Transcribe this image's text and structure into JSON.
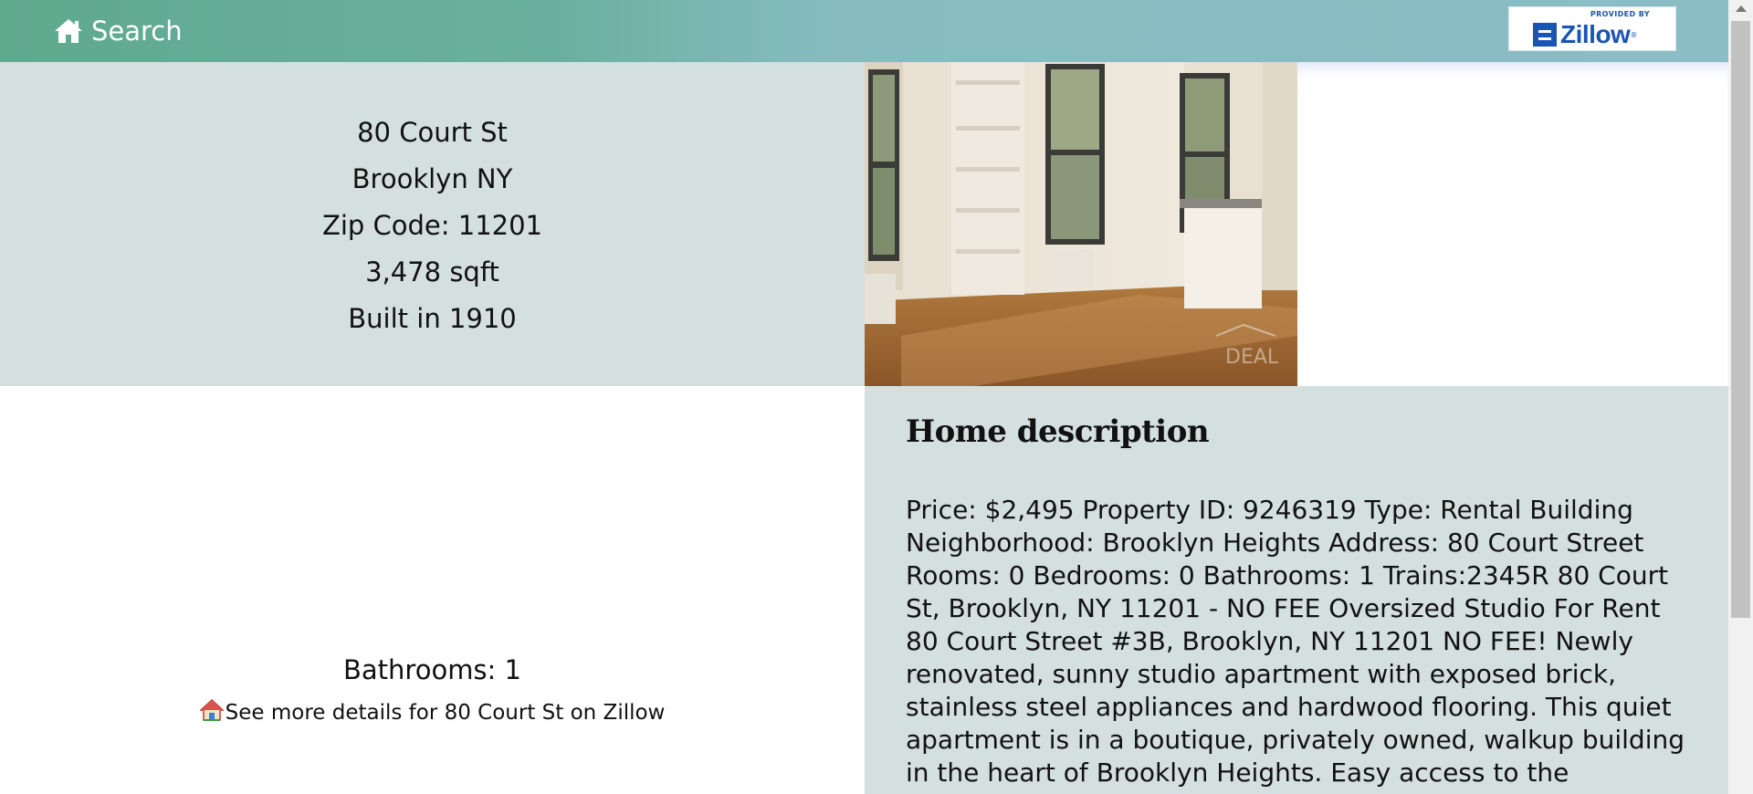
{
  "navbar": {
    "search_label": "Search",
    "search_icon": "home-icon",
    "zillow_badge": {
      "provided_by": "PROVIDED BY",
      "brand": "Zillow",
      "registered": "®"
    }
  },
  "property": {
    "street": "80 Court St",
    "city_state": "Brooklyn NY",
    "zip_line": "Zip Code: 11201",
    "area": "3,478 sqft",
    "built": "Built in 1910",
    "bathrooms": "Bathrooms: 1",
    "zillow_link": "See more details for 80 Court St on Zillow"
  },
  "photo": {
    "watermark": "DEAL"
  },
  "description": {
    "title": "Home description",
    "body": "Price: $2,495 Property ID: 9246319 Type: Rental Building Neighborhood: Brooklyn Heights Address: 80 Court Street Rooms: 0 Bedrooms: 0 Bathrooms: 1 Trains:2345R 80 Court St, Brooklyn, NY 11201 - NO FEE Oversized Studio For Rent 80 Court Street #3B, Brooklyn, NY 11201 NO FEE! Newly renovated, sunny studio apartment with exposed brick, stainless steel appliances and hardwood flooring. This quiet apartment is in a boutique, privately owned, walkup building in the heart of Brooklyn Heights. Easy access to the"
  },
  "colors": {
    "nav_start": "#5fa98f",
    "nav_end": "#8bbdc4",
    "panel_bg": "#d4e0df",
    "zillow_blue": "#1b55b3"
  }
}
